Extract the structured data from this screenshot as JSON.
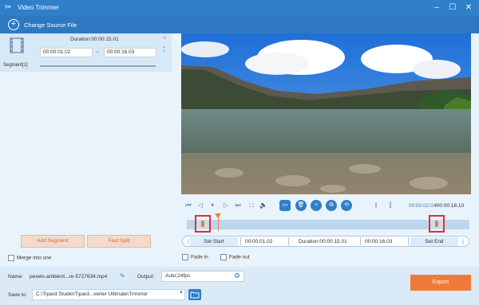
{
  "window": {
    "title": "Video Trimmer",
    "minimize": "–",
    "maximize": "☐",
    "close": "✕"
  },
  "toolbar": {
    "change_source": "Change Source File"
  },
  "segment": {
    "label": "Segment[1]",
    "duration": "Duration:00:00:15.01",
    "start": "00:00:01.02",
    "end": "00:00:16.03",
    "dash": "–"
  },
  "left_buttons": {
    "add_segment": "Add Segment",
    "fast_split": "Fast Split"
  },
  "merge": {
    "label": "Merge into one"
  },
  "player": {
    "current_time": "00:00:02.04",
    "total_time": "/00:00:18.10",
    "playhead_fraction": 0.11
  },
  "trim": {
    "set_start": "Set Start",
    "start_time": "00:00:01.02",
    "duration": "Duration:00:00:15.01",
    "end_time": "00:00:16.03",
    "set_end": "Set End",
    "start_fraction": 0.056,
    "end_fraction": 0.885
  },
  "fade": {
    "fade_in": "Fade in",
    "fade_out": "Fade out"
  },
  "output": {
    "name_label": "Name:",
    "name_value": "pexels-ambient...re-5727634.mp4",
    "output_label": "Output:",
    "output_value": "Auto;24fps",
    "save_label": "Save to:",
    "save_path": "C:\\Tipard Studio\\Tipard...verter Ultimate\\Trimmer",
    "export": "Export"
  },
  "colors": {
    "accent": "#2f7fc9",
    "orange": "#f07a3a",
    "handle_border": "#e03030"
  }
}
